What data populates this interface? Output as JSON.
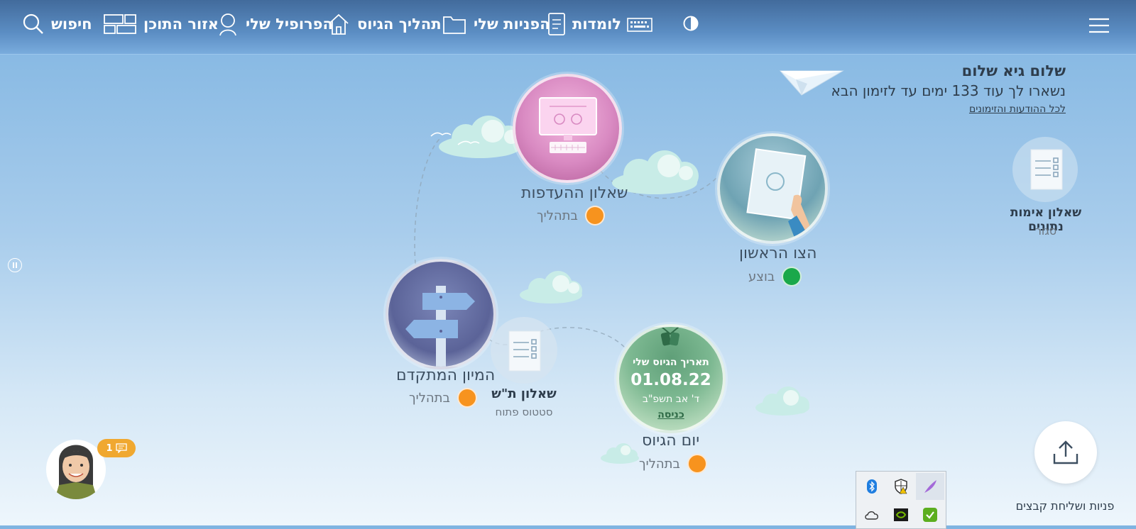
{
  "nav": {
    "search_label": "חיפוש",
    "content_area_label": "אזור התוכן",
    "profile_label": "הפרופיל שלי",
    "process_label": "תהליך הגיוס",
    "requests_label": "הפניות שלי",
    "lomdot_label": "לומדות"
  },
  "greeting": {
    "title": "שלום גיא שלום",
    "days_text": "נשארו לך עוד 133 ימים עד לזימון הבא",
    "link": "לכל ההודעות והזימונים"
  },
  "nodes": {
    "preferences": {
      "title": "שאלון ההעדפות",
      "status": "בתהליך"
    },
    "first_tsav": {
      "title": "הצו הראשון",
      "status": "בוצע"
    },
    "data_verification": {
      "title": "שאלון אימות נתונים",
      "status": "סגור"
    },
    "focused_sorting": {
      "title": "המיון המתקדם",
      "status": "בתהליך"
    },
    "tash_questionnaire": {
      "title": "שאלון ת\"ש",
      "status": "סטטוס פתוח"
    },
    "draft_day": {
      "title": "יום הגיוס",
      "status": "בתהליך",
      "inner_title": "תאריך הגיוס שלי",
      "date": "01.08.22",
      "hebrew_date": "ד' אב תשפ\"ב",
      "entry_link": "כניסה"
    }
  },
  "chat": {
    "badge_count": "1"
  },
  "upload": {
    "label": "פניות ושליחת קבצים"
  },
  "colors": {
    "status_in_progress": "#f7931e",
    "status_done": "#1aa84a",
    "topbar": "#4d7bb0"
  }
}
